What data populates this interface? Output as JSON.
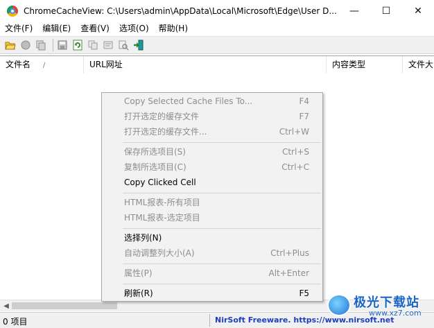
{
  "window": {
    "title": "ChromeCacheView:   C:\\Users\\admin\\AppData\\Local\\Microsoft\\Edge\\User D...",
    "minimize_glyph": "—",
    "maximize_glyph": "☐",
    "close_glyph": "✕"
  },
  "menu": [
    "文件(F)",
    "编辑(E)",
    "查看(V)",
    "选项(O)",
    "帮助(H)"
  ],
  "toolbar": {
    "icons": [
      "open-folder-icon",
      "stop-icon",
      "copy-files-icon",
      "save-icon",
      "refresh-icon",
      "copy-icon",
      "properties-icon",
      "find-icon",
      "exit-icon"
    ]
  },
  "columns": [
    {
      "label": "文件名",
      "sort": "/"
    },
    {
      "label": "URL网址"
    },
    {
      "label": "内容类型"
    },
    {
      "label": "文件大"
    }
  ],
  "context_menu": {
    "items": [
      {
        "label": "Copy Selected Cache Files To...",
        "shortcut": "F4",
        "enabled": false
      },
      {
        "label": "打开选定的缓存文件",
        "shortcut": "F7",
        "enabled": false
      },
      {
        "label": "打开选定的缓存文件...",
        "shortcut": "Ctrl+W",
        "enabled": false
      },
      {
        "label": "保存所选项目(S)",
        "shortcut": "Ctrl+S",
        "enabled": false
      },
      {
        "label": "复制所选项目(C)",
        "shortcut": "Ctrl+C",
        "enabled": false
      },
      {
        "label": "Copy Clicked Cell",
        "shortcut": "",
        "enabled": true
      },
      {
        "label": "HTML报表-所有项目",
        "shortcut": "",
        "enabled": false
      },
      {
        "label": "HTML报表-选定项目",
        "shortcut": "",
        "enabled": false
      },
      {
        "label": "选择列(N)",
        "shortcut": "",
        "enabled": true
      },
      {
        "label": "自动调整列大小(A)",
        "shortcut": "Ctrl+Plus",
        "enabled": false
      },
      {
        "label": "属性(P)",
        "shortcut": "Alt+Enter",
        "enabled": false
      },
      {
        "label": "刷新(R)",
        "shortcut": "F5",
        "enabled": true
      }
    ]
  },
  "scrollbar": {
    "left_arrow": "◀"
  },
  "status": {
    "count": "0 项目",
    "link": "NirSoft Freeware. https://www.nirsoft.net"
  },
  "watermark": {
    "text": "极光下载站",
    "url": "www.xz7.com"
  }
}
